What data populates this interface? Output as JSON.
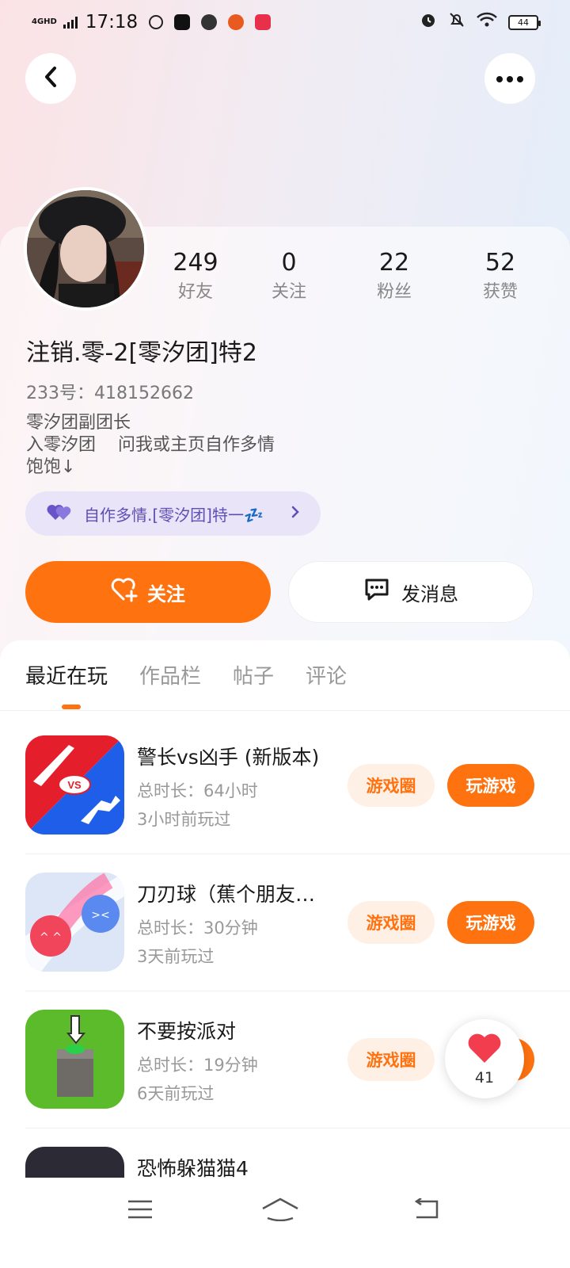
{
  "status_bar": {
    "network": "4GHD",
    "time": "17:18",
    "battery": "44"
  },
  "profile": {
    "stats": [
      {
        "value": "249",
        "label": "好友"
      },
      {
        "value": "0",
        "label": "关注"
      },
      {
        "value": "22",
        "label": "粉丝"
      },
      {
        "value": "52",
        "label": "获赞"
      }
    ],
    "nickname": "注销.零-2[零汐团]特2",
    "uid": "233号：418152662",
    "bio": [
      "零汐团副团长",
      "入零汐团    问我或主页自作多情",
      "饱饱↓"
    ],
    "tag": "自作多情.[零汐团]特一💤",
    "follow_label": "关注",
    "message_label": "发消息"
  },
  "tabs": [
    "最近在玩",
    "作品栏",
    "帖子",
    "评论"
  ],
  "games": [
    {
      "title": "警长vs凶手 (新版本)",
      "duration": "总时长：64小时",
      "last_played": "3小时前玩过"
    },
    {
      "title": "刀刃球（蕉个朋友…",
      "duration": "总时长：30分钟",
      "last_played": "3天前玩过"
    },
    {
      "title": "不要按派对",
      "duration": "总时长：19分钟",
      "last_played": "6天前玩过"
    },
    {
      "title": "恐怖躲猫猫4",
      "duration": "",
      "last_played": ""
    }
  ],
  "game_buttons": {
    "circle": "游戏圈",
    "play": "玩游戏"
  },
  "like_count": "41",
  "colors": {
    "accent": "#ff7210",
    "accent_light": "#fff0e6",
    "tag_bg": "#e9e4f7",
    "tag_text": "#5e4fb6"
  }
}
